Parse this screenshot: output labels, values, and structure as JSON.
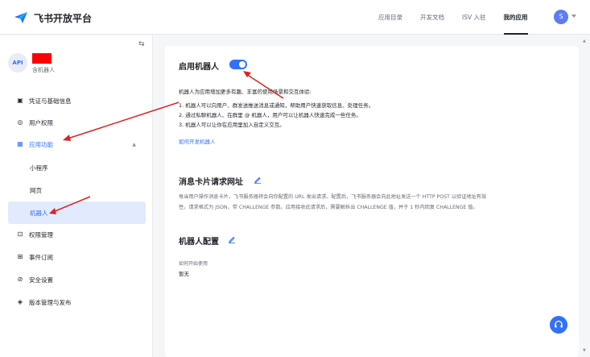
{
  "header": {
    "brand_name": "飞书开放平台",
    "nav": [
      {
        "label": "应用目录"
      },
      {
        "label": "开发文档"
      },
      {
        "label": "ISV 入驻"
      },
      {
        "label": "我的应用"
      }
    ],
    "avatar_initial": "S"
  },
  "sidebar": {
    "app_avatar": "API",
    "app_subtitle": "含机器人",
    "items": [
      {
        "label": "凭证与基础信息"
      },
      {
        "label": "用户权限"
      },
      {
        "label": "应用功能"
      },
      {
        "label": "权限管理"
      },
      {
        "label": "事件订阅"
      },
      {
        "label": "安全设置"
      },
      {
        "label": "版本管理与发布"
      }
    ],
    "sub_items": [
      {
        "label": "小程序"
      },
      {
        "label": "网页"
      },
      {
        "label": "机器人"
      }
    ]
  },
  "main": {
    "bot_section": {
      "title": "启用机器人",
      "enabled": true,
      "intro": "机器人为应用增加更多有趣、丰富的使用场景和交互体验:",
      "points": [
        "1. 机器人可以向用户、群发送推送消息或通知，帮助用户快速获取信息、处理任务。",
        "2. 通过私聊机器人、在群里 @ 机器人，用户可以让机器人快速完成一些任务。",
        "3. 机器人可以让你在应用里加入自定义交互。"
      ],
      "link": "如何开发机器人"
    },
    "card_section": {
      "title": "消息卡片请求网址",
      "desc_1": "每当用户操作消息卡片，飞书服务器将会向你配置的 URL 发出请求。配置后，飞书服务器会向此地址发送一个 HTTP POST 以验证地址有效",
      "desc_2": "性，请求格式为 JSON，带 CHALLENGE 参数。应用接收此请求后，需要解析出 CHALLENGE 值，并于 1 秒内回复 CHALLENGE 值。"
    },
    "config_section": {
      "title": "机器人配置",
      "field_label": "如何开始使用",
      "field_value": "暂无"
    }
  },
  "colors": {
    "accent": "#3370ff",
    "annotation_arrow": "#e02020",
    "redaction": "#ff0000"
  }
}
